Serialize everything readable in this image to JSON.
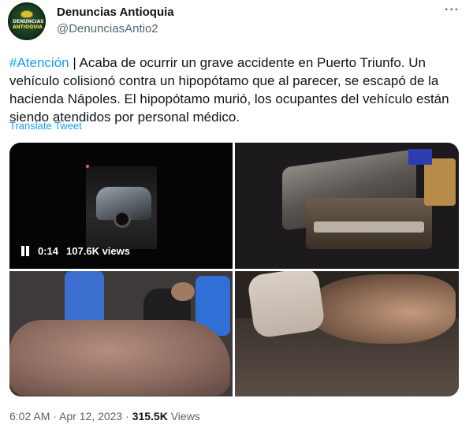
{
  "author": {
    "display_name": "Denuncias Antioquia",
    "handle": "@DenunciasAntio2",
    "avatar_text_line1": "DENUNCIAS",
    "avatar_text_line2": "ANTIOQUIA"
  },
  "tweet": {
    "hashtag": "#Atención",
    "body": " | Acaba de ocurrir un grave accidente en Puerto Triunfo. Un vehículo colisionó contra un hipopótamo que al parecer, se escapó de la hacienda Nápoles. El hipopótamo murió, los ocupantes del vehículo están siendo atendidos por personal médico.",
    "translate_label": "Translate Tweet"
  },
  "media": {
    "video": {
      "time": "0:14",
      "views": "107.6K views"
    }
  },
  "meta": {
    "time": "6:02 AM",
    "separator1": " · ",
    "date": "Apr 12, 2023",
    "separator2": " · ",
    "views_count": "315.5K",
    "views_label": " Views"
  },
  "colors": {
    "accent": "#1d9bf0",
    "text": "#0f1419",
    "secondary": "#536471"
  },
  "icons": {
    "more": "more-options-icon",
    "pause": "pause-icon"
  }
}
